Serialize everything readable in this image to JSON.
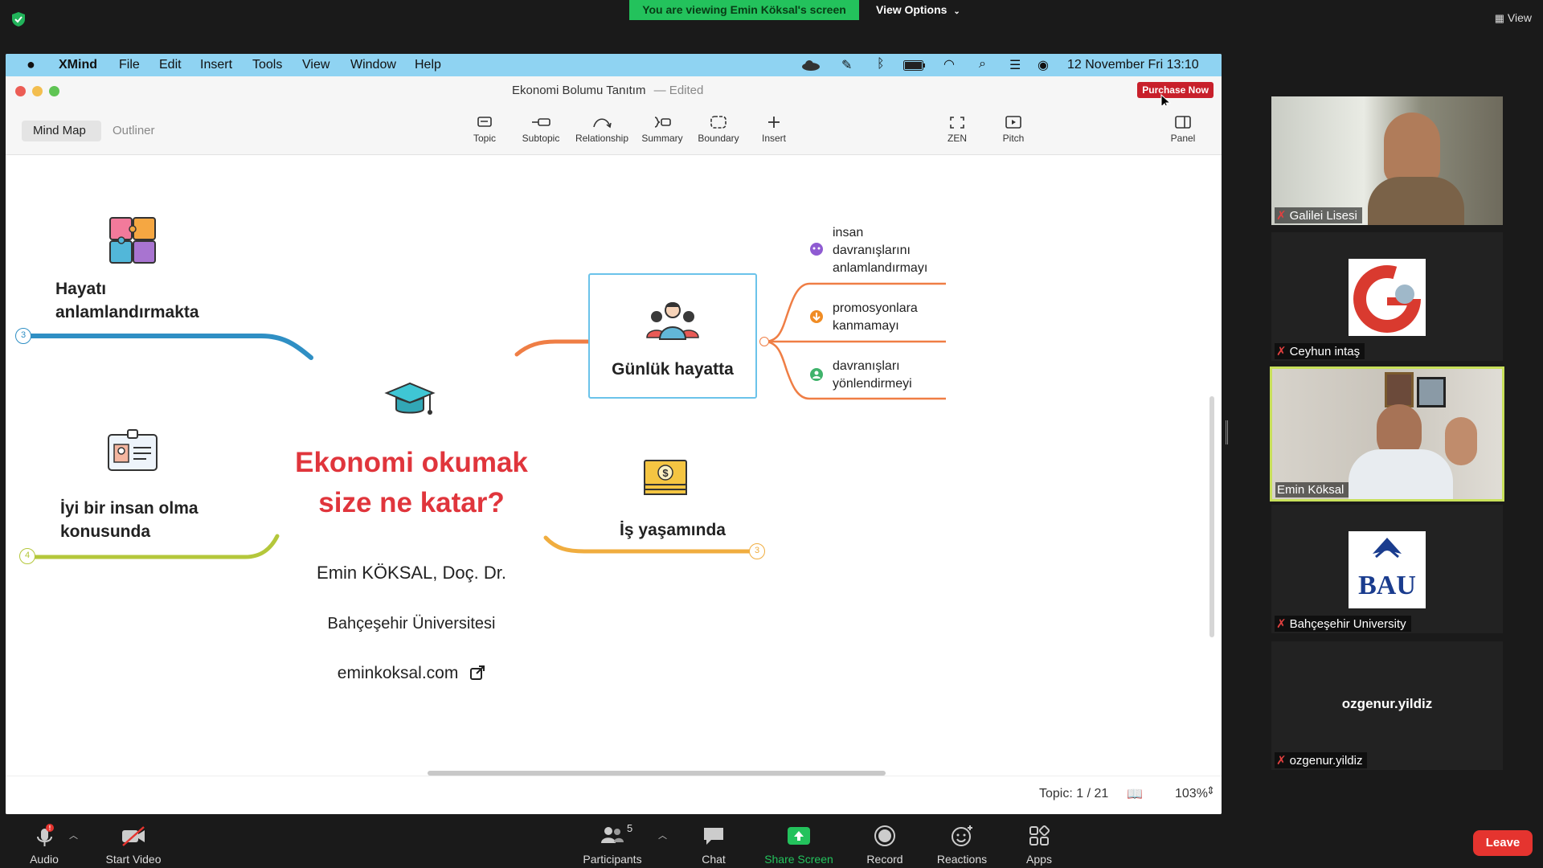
{
  "zoom": {
    "viewing_banner": "You are viewing Emin Köksal's screen",
    "view_options": "View Options",
    "view_button": "View",
    "participants_count": "5",
    "toolbar": {
      "audio": "Audio",
      "start_video": "Start Video",
      "participants": "Participants",
      "chat": "Chat",
      "share_screen": "Share Screen",
      "record": "Record",
      "reactions": "Reactions",
      "apps": "Apps",
      "leave": "Leave"
    },
    "participants": [
      {
        "name": "Galilei Lisesi"
      },
      {
        "name": "Ceyhun intaş"
      },
      {
        "name": "Emin Köksal"
      },
      {
        "name": "Bahçeşehir University"
      },
      {
        "name": "ozgenur.yildiz",
        "center_label": "ozgenur.yildiz"
      }
    ],
    "colors": {
      "banner": "#23c25c",
      "leave": "#e5342f",
      "active_speaker": "#c8e05a"
    }
  },
  "mac_menubar": {
    "app": "XMind",
    "menus": [
      "File",
      "Edit",
      "Insert",
      "Tools",
      "View",
      "Window",
      "Help"
    ],
    "datetime": "12 November Fri  13:10"
  },
  "xmind": {
    "doc_title": "Ekonomi Bolumu Tanıtım",
    "doc_state": "— Edited",
    "purchase": "Purchase Now",
    "modes": [
      "Mind Map",
      "Outliner"
    ],
    "tools": [
      "Topic",
      "Subtopic",
      "Relationship",
      "Summary",
      "Boundary",
      "Insert"
    ],
    "right_tools": [
      "ZEN",
      "Pitch",
      "Panel"
    ],
    "status": {
      "topic": "Topic: 1 / 21",
      "zoom": "103%"
    },
    "map": {
      "central_title_line1": "Ekonomi okumak",
      "central_title_line2": "size ne katar?",
      "author": "Emin KÖKSAL, Doç. Dr.",
      "university": "Bahçeşehir Üniversitesi",
      "website": "eminkoksal.com",
      "branches": {
        "top_left_line1": "Hayatı",
        "top_left_line2": "anlamlandırmakta",
        "top_left_count": "3",
        "bottom_left_line1": "İyi bir insan olma",
        "bottom_left_line2": "konusunda",
        "bottom_left_count": "4",
        "top_right": "Günlük hayatta",
        "bottom_right": "İş yaşamında",
        "bottom_right_count": "3"
      },
      "subtopics": [
        {
          "line1": "insan",
          "line2": "davranışlarını",
          "line3": "anlamlandırmayı"
        },
        {
          "line1": "promosyonlara",
          "line2": "kanmamayı"
        },
        {
          "line1": "davranışları",
          "line2": "yönlendirmeyi"
        }
      ]
    }
  }
}
